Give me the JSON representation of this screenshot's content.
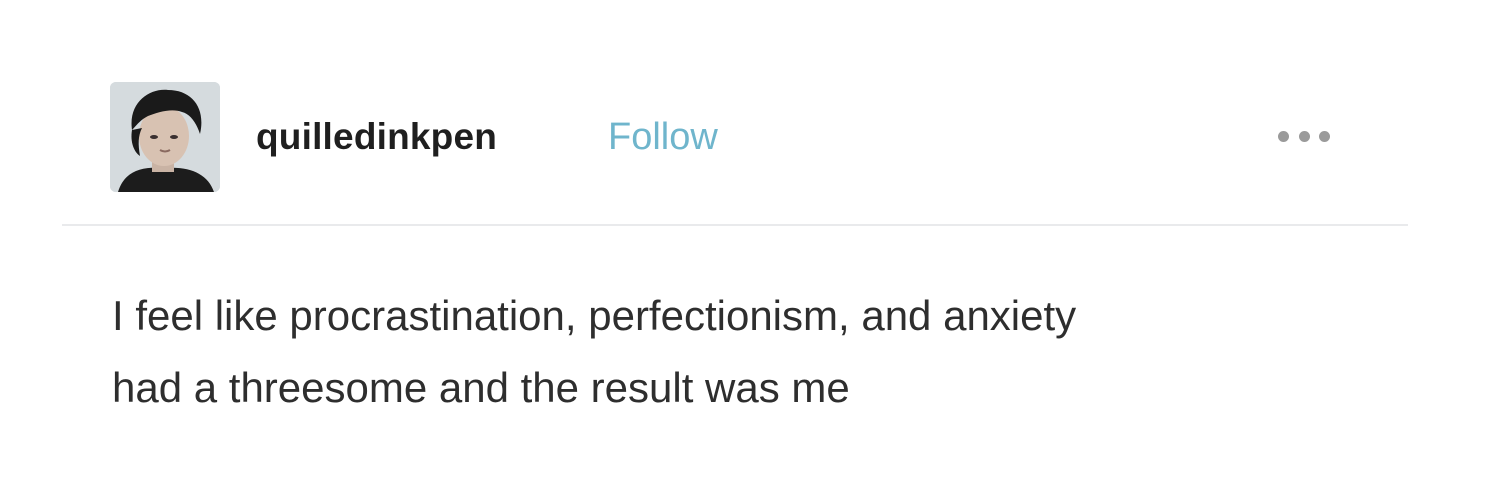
{
  "post": {
    "author": {
      "username": "quilledinkpen",
      "follow_label": "Follow",
      "avatar_icon": "user-avatar-photo"
    },
    "menu_icon": "more-options-icon",
    "text_lines": [
      "I feel like procrastination, perfectionism, and anxiety",
      "had a threesome and the result was me"
    ],
    "colors": {
      "follow": "#6fb5cc",
      "text": "#2e2e2e",
      "divider": "#e9eaec"
    }
  }
}
